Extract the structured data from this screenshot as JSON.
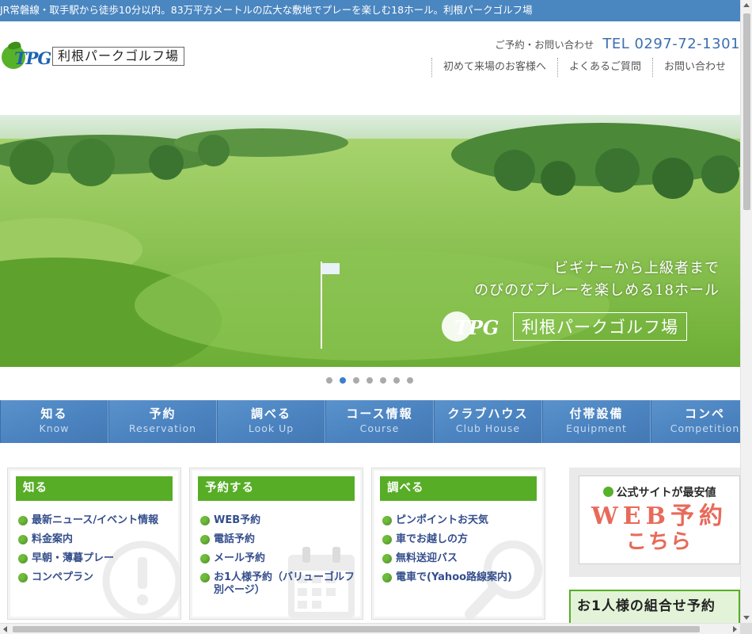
{
  "topbar": {
    "text": "JR常磐線・取手駅から徒歩10分以内。83万平方メートルの広大な敷地でプレーを楽しむ18ホール。利根パークゴルフ場"
  },
  "header": {
    "logo_mark": "TPG",
    "logo_name": "利根パークゴルフ場",
    "contact_label": "ご予約・お問い合わせ",
    "tel": "TEL 0297-72-1301",
    "subnav": [
      "初めて来場のお客様へ",
      "よくあるご質問",
      "お問い合わせ"
    ]
  },
  "hero": {
    "caption_line1": "ビギナーから上級者まで",
    "caption_line2": "のびのびプレーを楽しめる18ホール",
    "logo_mark": "TPG",
    "logo_name": "利根パークゴルフ場",
    "slide_count": 7,
    "active_slide": 2
  },
  "gnav": [
    {
      "jp": "知る",
      "en": "Know"
    },
    {
      "jp": "予約",
      "en": "Reservation"
    },
    {
      "jp": "調べる",
      "en": "Look Up"
    },
    {
      "jp": "コース情報",
      "en": "Course"
    },
    {
      "jp": "クラブハウス",
      "en": "Club House"
    },
    {
      "jp": "付帯設備",
      "en": "Equipment"
    },
    {
      "jp": "コンペ",
      "en": "Competition"
    }
  ],
  "panels": {
    "know": {
      "title": "知る",
      "icon": "exclamation-icon",
      "items": [
        "最新ニュース/イベント情報",
        "料金案内",
        "早朝・薄暮プレー",
        "コンペプラン"
      ]
    },
    "reserve": {
      "title": "予約する",
      "icon": "calendar-icon",
      "items": [
        "WEB予約",
        "電話予約",
        "メール予約",
        "お1人様予約（バリューゴルフ別ページ）"
      ]
    },
    "lookup": {
      "title": "調べる",
      "icon": "magnifier-icon",
      "items": [
        "ピンポイントお天気",
        "車でお越しの方",
        "無料送迎バス",
        "電車で(Yahoo路線案内)"
      ]
    }
  },
  "side": {
    "web_top": "公式サイトが最安値",
    "web_big": "WEB予約",
    "web_sub": "こちら",
    "single_banner": "お1人様の組合せ予約"
  },
  "colors": {
    "topbar": "#4a86c0",
    "nav": "#4b83c0",
    "panel_head": "#57ad26",
    "link": "#344e8c",
    "accent_red": "#e86a5a"
  }
}
